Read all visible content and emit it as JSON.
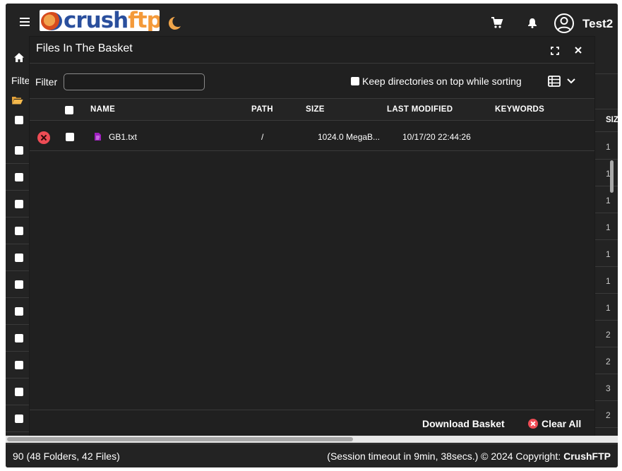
{
  "header": {
    "logo_text_crush": "crush",
    "logo_text_ftp": "ftp",
    "user_name": "Test2"
  },
  "background": {
    "filter_partial": "Filte",
    "size_header_partial": "SIZ",
    "right_values": [
      "1",
      "1",
      "1",
      "1",
      "1",
      "1",
      "1",
      "2",
      "2",
      "3",
      "2"
    ]
  },
  "modal": {
    "title": "Files In The Basket",
    "filter_label": "Filter",
    "filter_value": "",
    "filter_placeholder": "",
    "keep_dirs_label": "Keep directories on top while sorting",
    "columns": [
      "NAME",
      "PATH",
      "SIZE",
      "LAST MODIFIED",
      "KEYWORDS"
    ],
    "rows": [
      {
        "name": "GB1.txt",
        "path": "/",
        "size": "1024.0 MegaB...",
        "modified": "10/17/20 22:44:26",
        "keywords": ""
      }
    ],
    "download_label": "Download Basket",
    "clear_label": "Clear All"
  },
  "footer": {
    "count": "90 (48 Folders, 42 Files)",
    "session": "(Session timeout in 9min, 38secs.) © 2024 Copyright: ",
    "brand": "CrushFTP"
  },
  "colors": {
    "background": "#232323",
    "modal": "#202020",
    "danger": "#ee4c55",
    "file_icon": "#a020c0",
    "moon": "#f0a54a"
  },
  "icons": [
    "menu-icon",
    "cart-icon",
    "bell-icon",
    "user-circle-icon",
    "moon-icon",
    "home-icon",
    "folder-icon",
    "expand-icon",
    "close-icon",
    "table-view-icon",
    "chevron-down-icon",
    "remove-icon",
    "file-icon"
  ]
}
